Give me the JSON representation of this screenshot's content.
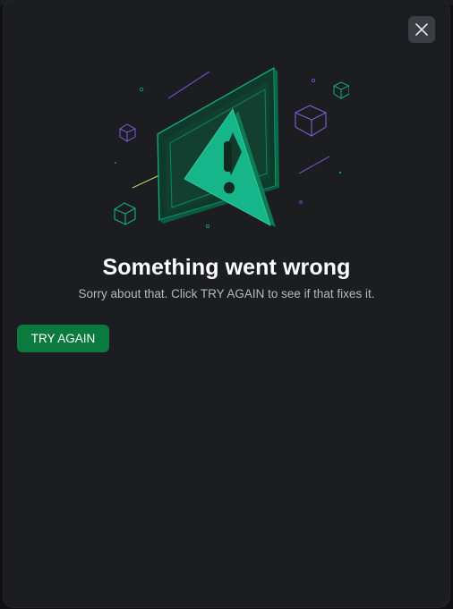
{
  "dialog": {
    "title": "Something went wrong",
    "message": "Sorry about that. Click TRY AGAIN to see if that fixes it.",
    "try_again_label": "TRY AGAIN"
  },
  "icons": {
    "close": "close-icon",
    "illustration": "error-warning-illustration"
  },
  "colors": {
    "background": "#1c1d21",
    "accent_green": "#0b7a3e",
    "illustration_green": "#10b07a",
    "illustration_purple": "#7b5cd6",
    "title_text": "#ffffff",
    "body_text": "#b7b9bf"
  }
}
